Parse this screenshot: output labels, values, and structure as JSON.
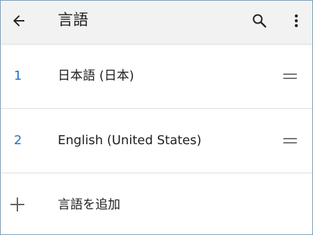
{
  "colors": {
    "accent": "#1e72c8",
    "appbar_background": "#f2f2f2",
    "text": "#212121",
    "icon": "#616161",
    "divider": "#dcdcdc"
  },
  "toolbar": {
    "back_icon": "arrow-back-icon",
    "title": "言語",
    "search_icon": "search-icon",
    "more_icon": "more-vert-icon"
  },
  "languages": [
    {
      "index": "1",
      "label": "日本語 (日本)",
      "handle_icon": "drag-handle-icon"
    },
    {
      "index": "2",
      "label": "English (United States)",
      "handle_icon": "drag-handle-icon"
    }
  ],
  "add_language": {
    "icon": "plus-icon",
    "label": "言語を追加"
  }
}
